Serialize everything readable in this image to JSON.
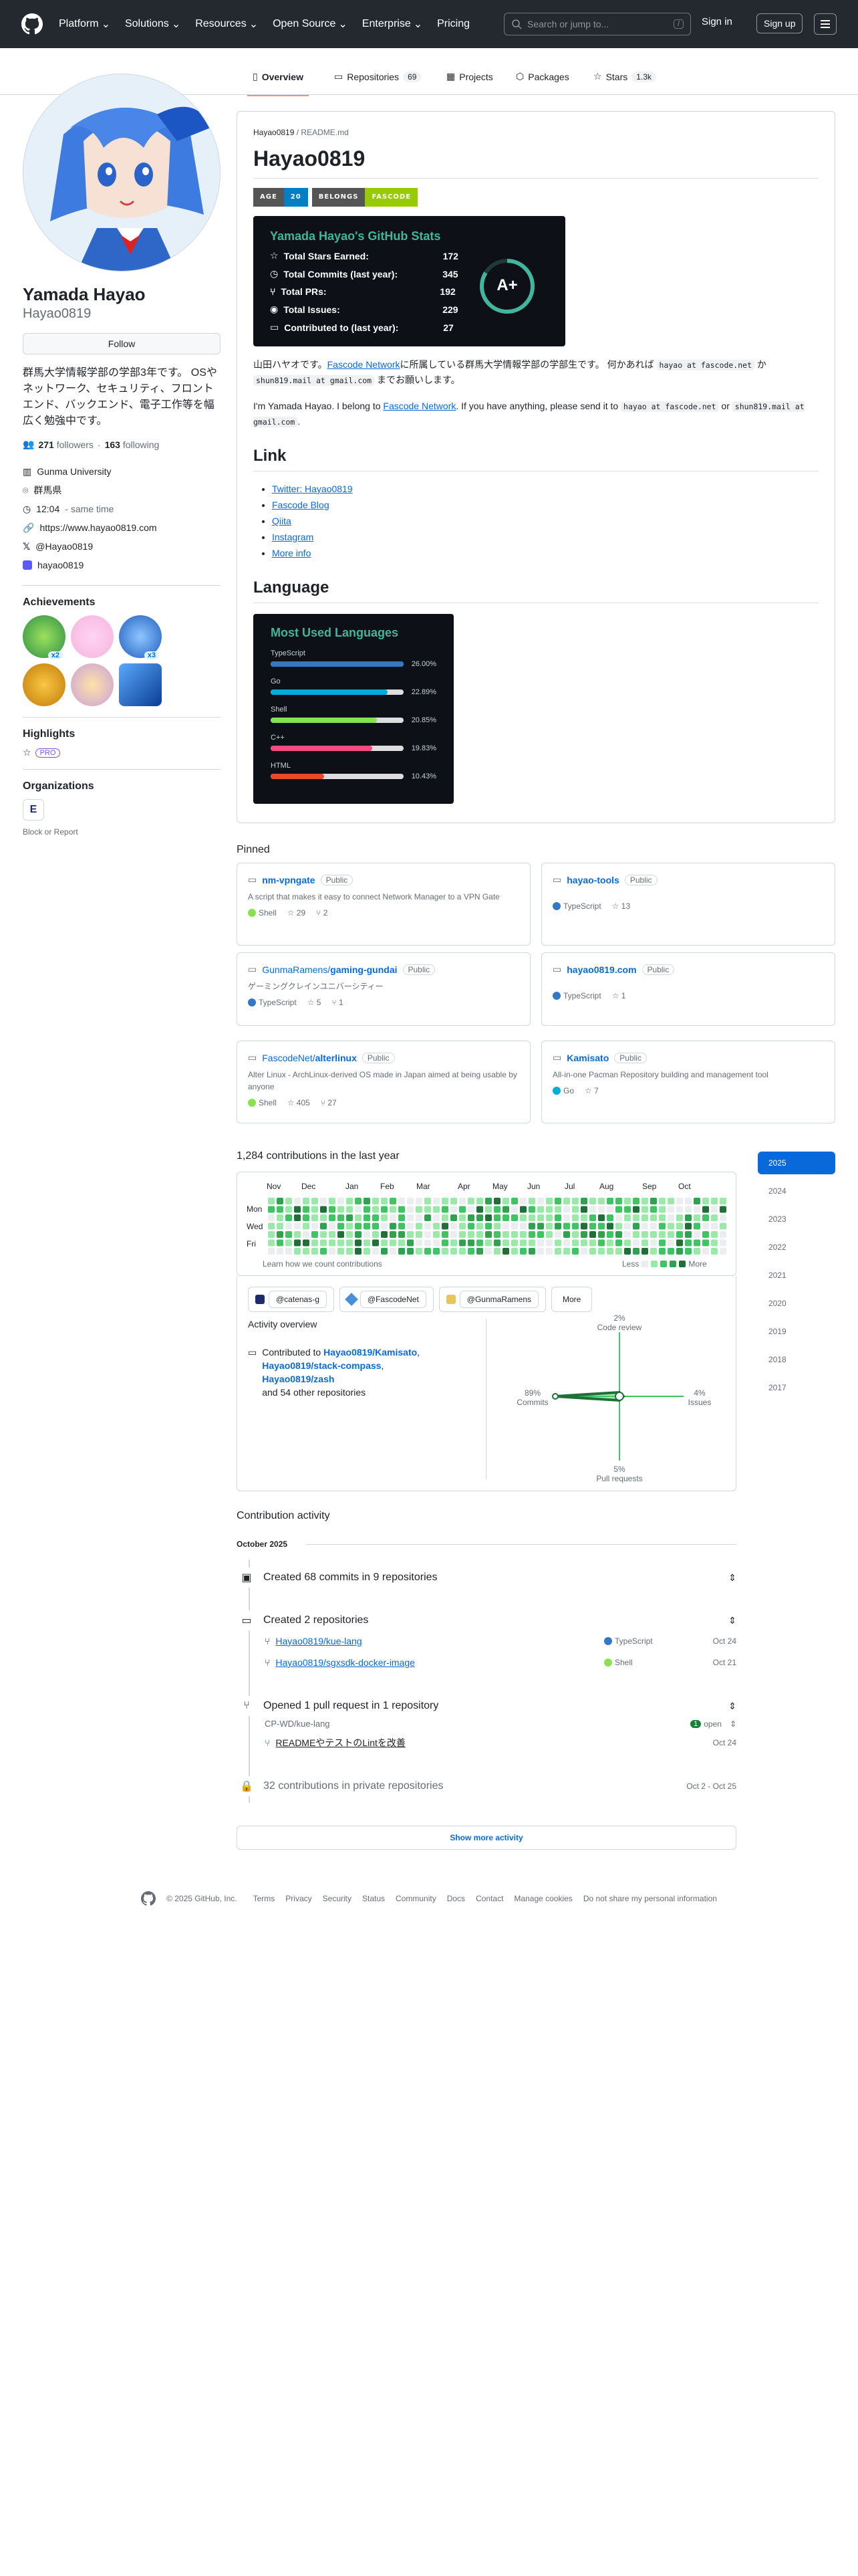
{
  "header": {
    "nav": [
      "Platform",
      "Solutions",
      "Resources",
      "Open Source",
      "Enterprise",
      "Pricing"
    ],
    "search_placeholder": "Search or jump to...",
    "search_shortcut": "/",
    "signin": "Sign in",
    "signup": "Sign up"
  },
  "tabs": [
    {
      "label": "Overview"
    },
    {
      "label": "Repositories",
      "count": "69"
    },
    {
      "label": "Projects"
    },
    {
      "label": "Packages"
    },
    {
      "label": "Stars",
      "count": "1.3k"
    }
  ],
  "profile": {
    "name": "Yamada Hayao",
    "login": "Hayao0819",
    "follow": "Follow",
    "bio": "群馬大学情報学部の学部3年です。 OSやネットワーク、セキュリティ、フロントエンド、バックエンド、電子工作等を幅広く勉強中です。",
    "followers": "271",
    "followers_label": "followers",
    "following": "163",
    "following_label": "following",
    "org": "Gunma University",
    "location": "群馬県",
    "time": "12:04",
    "time_note": "- same time",
    "url": "https://www.hayao0819.com",
    "x": "@Hayao0819",
    "mastodon": "hayao0819",
    "achievements_title": "Achievements",
    "achievement_counts": [
      "x2",
      "x3"
    ],
    "highlights_title": "Highlights",
    "pro": "PRO",
    "orgs_title": "Organizations",
    "block": "Block or Report"
  },
  "readme": {
    "crumb_user": "Hayao0819",
    "crumb_file": "README.md",
    "title": "Hayao0819",
    "shields": [
      {
        "l": "AGE",
        "r": "20",
        "color": "#007ec6"
      },
      {
        "l": "BELONGS",
        "r": "FASCODE",
        "color": "#97ca00"
      }
    ],
    "stats": {
      "title": "Yamada Hayao's GitHub Stats",
      "rows": [
        {
          "k": "Total Stars Earned:",
          "v": "172"
        },
        {
          "k": "Total Commits (last year):",
          "v": "345"
        },
        {
          "k": "Total PRs:",
          "v": "192"
        },
        {
          "k": "Total Issues:",
          "v": "229"
        },
        {
          "k": "Contributed to (last year):",
          "v": "27"
        }
      ],
      "grade": "A+"
    },
    "p1_a": "山田ハヤオです。",
    "p1_link": "Fascode Network",
    "p1_b": "に所属している群馬大学情報学部の学部生です。 何かあれば",
    "p1_code1": "hayao at fascode.net",
    "p1_c": "か",
    "p1_code2": "shun819.mail at gmail.com",
    "p1_d": "までお願いします。",
    "p2_a": "I'm Yamada Hayao. I belong to",
    "p2_link": "Fascode Network",
    "p2_b": ". If you have anything, please send it to",
    "p2_code1": "hayao at fascode.net",
    "p2_c": "or",
    "p2_code2": "shun819.mail at gmail.com",
    "p2_d": ".",
    "link_title": "Link",
    "links": [
      "Twitter: Hayao0819",
      "Fascode Blog",
      "Qiita",
      "Instagram",
      "More info"
    ],
    "lang_title": "Language",
    "langs_card_title": "Most Used Languages",
    "langs": [
      {
        "name": "TypeScript",
        "pct": "26.00%",
        "v": 26.0,
        "color": "#3178c6"
      },
      {
        "name": "Go",
        "pct": "22.89%",
        "v": 22.89,
        "color": "#00add8"
      },
      {
        "name": "Shell",
        "pct": "20.85%",
        "v": 20.85,
        "color": "#89e051"
      },
      {
        "name": "C++",
        "pct": "19.83%",
        "v": 19.83,
        "color": "#f34b7d"
      },
      {
        "name": "HTML",
        "pct": "10.43%",
        "v": 10.43,
        "color": "#e34c26"
      }
    ]
  },
  "pinned": {
    "title": "Pinned",
    "public": "Public",
    "items": [
      {
        "owner": "",
        "name": "nm-vpngate",
        "desc": "A script that makes it easy to connect Network Manager to a VPN Gate",
        "lang": "Shell",
        "color": "#89e051",
        "stars": "29",
        "forks": "2"
      },
      {
        "owner": "",
        "name": "hayao-tools",
        "desc": "",
        "lang": "TypeScript",
        "color": "#3178c6",
        "stars": "13",
        "forks": ""
      },
      {
        "owner": "GunmaRamens/",
        "name": "gaming-gundai",
        "desc": "ゲーミングクレインユニバーシティー",
        "lang": "TypeScript",
        "color": "#3178c6",
        "stars": "5",
        "forks": "1"
      },
      {
        "owner": "",
        "name": "hayao0819.com",
        "desc": "",
        "lang": "TypeScript",
        "color": "#3178c6",
        "stars": "1",
        "forks": ""
      },
      {
        "owner": "FascodeNet/",
        "name": "alterlinux",
        "desc": "Alter Linux - ArchLinux-derived OS made in Japan aimed at being usable by anyone",
        "lang": "Shell",
        "color": "#89e051",
        "stars": "405",
        "forks": "27"
      },
      {
        "owner": "",
        "name": "Kamisato",
        "desc": "All-in-one Pacman Repository building and management tool",
        "lang": "Go",
        "color": "#00add8",
        "stars": "7",
        "forks": ""
      }
    ]
  },
  "contrib": {
    "title": "1,284 contributions in the last year",
    "months": [
      "Nov",
      "Dec",
      "Jan",
      "Feb",
      "Mar",
      "Apr",
      "May",
      "Jun",
      "Jul",
      "Aug",
      "Sep",
      "Oct"
    ],
    "days": [
      "Mon",
      "Wed",
      "Fri"
    ],
    "learn": "Learn how we count contributions",
    "less": "Less",
    "more": "More",
    "years": [
      "2025",
      "2024",
      "2023",
      "2022",
      "2021",
      "2020",
      "2019",
      "2018",
      "2017"
    ],
    "orgs": [
      "@catenas-g",
      "@FascodeNet",
      "@GunmaRamens"
    ],
    "orgs_more": "More",
    "overview_title": "Activity overview",
    "contributed_to": "Contributed to",
    "repos": [
      "Hayao0819/Kamisato",
      "Hayao0819/stack-compass",
      "Hayao0819/zash"
    ],
    "others": "and 54 other repositories",
    "axes": [
      {
        "pct": "2%",
        "label": "Code review",
        "v": 2
      },
      {
        "pct": "4%",
        "label": "Issues",
        "v": 4
      },
      {
        "pct": "5%",
        "label": "Pull requests",
        "v": 5
      },
      {
        "pct": "89%",
        "label": "Commits",
        "v": 89
      }
    ]
  },
  "activity": {
    "title": "Contribution activity",
    "month": "October 2025",
    "commits": "Created 68 commits in 9 repositories",
    "repos_created": "Created 2 repositories",
    "new_repos": [
      {
        "name": "Hayao0819/kue-lang",
        "lang": "TypeScript",
        "color": "#3178c6",
        "date": "Oct 24"
      },
      {
        "name": "Hayao0819/sgxsdk-docker-image",
        "lang": "Shell",
        "color": "#89e051",
        "date": "Oct 21"
      }
    ],
    "pr_title": "Opened 1 pull request in 1 repository",
    "pr_repo": "CP-WD/kue-lang",
    "pr_count": "1",
    "pr_state": "open",
    "pr_name": "READMEやテストのLintを改善",
    "pr_date": "Oct 24",
    "private": "32 contributions in private repositories",
    "private_date": "Oct 2 - Oct 25",
    "show_more": "Show more activity"
  },
  "footer": [
    "© 2025 GitHub, Inc.",
    "Terms",
    "Privacy",
    "Security",
    "Status",
    "Community",
    "Docs",
    "Contact",
    "Manage cookies",
    "Do not share my personal information"
  ]
}
